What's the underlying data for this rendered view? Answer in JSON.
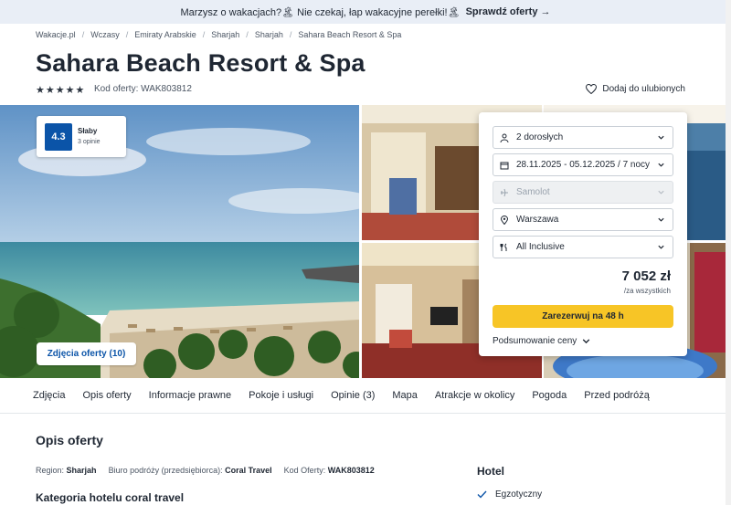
{
  "promo": {
    "text": "Marzysz o wakacjach?🏝 Nie czekaj, łap wakacyjne perełki!🏝",
    "link": "Sprawdź oferty →"
  },
  "breadcrumbs": [
    "Wakacje.pl",
    "Wczasy",
    "Emiraty Arabskie",
    "Sharjah",
    "Sharjah",
    "Sahara Beach Resort & Spa"
  ],
  "hotel": {
    "name": "Sahara Beach Resort & Spa",
    "stars": 5,
    "offer_code": "Kod oferty: WAK803812",
    "favorite": "Dodaj do ulubionych"
  },
  "rating": {
    "score": "4.3",
    "label": "Słaby",
    "count": "3 opinie"
  },
  "gallery": {
    "photos_button": "Zdjęcia oferty (10)"
  },
  "booking": {
    "travelers": "2 dorosłych",
    "dates": "28.11.2025 - 05.12.2025 / 7 nocy",
    "transport": "Samolot",
    "departure": "Warszawa",
    "board": "All Inclusive",
    "price": "7 052 zł",
    "price_note": "/za wszystkich",
    "reserve": "Zarezerwuj na 48 h",
    "summary": "Podsumowanie ceny"
  },
  "tabs": [
    "Zdjęcia",
    "Opis oferty",
    "Informacje prawne",
    "Pokoje i usługi",
    "Opinie (3)",
    "Mapa",
    "Atrakcje w okolicy",
    "Pogoda",
    "Przed podróżą"
  ],
  "description": {
    "title": "Opis oferty",
    "region_label": "Region:",
    "region": "Sharjah",
    "agency_label": "Biuro podróży (przedsiębiorca):",
    "agency": "Coral Travel",
    "code_label": "Kod Oferty:",
    "code": "WAK803812",
    "category_title": "Kategoria hotelu coral travel"
  },
  "hotel_box": {
    "title": "Hotel",
    "features": [
      "Egzotyczny"
    ]
  },
  "colors": {
    "accent": "#0b54a8",
    "cta": "#f7c526",
    "promo_bg": "#e9eef6"
  }
}
